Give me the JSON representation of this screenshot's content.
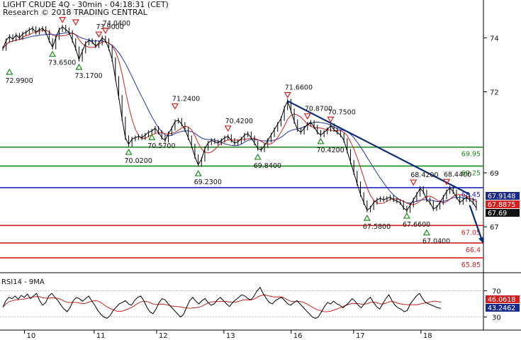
{
  "header": {
    "title": "LIGHT CRUDE 4Q - 30min - 04:18:31 (CET)",
    "copyright": "Research © 2018 TRADING CENTRAL"
  },
  "rsi_panel": {
    "title": "RSI14 - 9MA"
  },
  "chart_data": [
    {
      "type": "line",
      "title": "LIGHT CRUDE 4Q - 30min - 04:18:31 (CET)",
      "x_ticks": [
        "10",
        "11",
        "12",
        "13",
        "16",
        "17",
        "18"
      ],
      "y_ticks": [
        "74",
        "72",
        "69",
        "67"
      ],
      "ylim": [
        65.3,
        75.4
      ],
      "series": [
        {
          "role": "price",
          "color": "#000000",
          "values": [
            73.6,
            73.9,
            74.05,
            73.95,
            74.1,
            74.0,
            74.15,
            74.2,
            74.3,
            74.35,
            74.2,
            74.3,
            74.35,
            74.2,
            73.9,
            73.65,
            74.0,
            74.3,
            74.4,
            74.3,
            74.2,
            73.9,
            73.6,
            73.2,
            73.5,
            73.8,
            73.9,
            73.85,
            73.7,
            73.8,
            74.0,
            73.9,
            73.6,
            73.2,
            72.5,
            71.8,
            71.0,
            70.3,
            70.05,
            70.25,
            70.3,
            70.35,
            70.3,
            70.4,
            70.5,
            70.55,
            70.65,
            70.5,
            70.3,
            70.2,
            70.45,
            70.65,
            70.9,
            70.95,
            70.8,
            70.6,
            70.3,
            70.0,
            69.6,
            69.3,
            69.5,
            69.9,
            70.1,
            70.2,
            70.15,
            70.1,
            70.2,
            70.3,
            70.35,
            70.2,
            70.1,
            70.15,
            70.25,
            70.4,
            70.45,
            70.3,
            70.1,
            69.9,
            69.85,
            70.0,
            70.2,
            70.4,
            70.6,
            70.8,
            71.0,
            71.4,
            71.66,
            71.3,
            70.9,
            70.6,
            70.5,
            70.65,
            70.8,
            70.87,
            70.7,
            70.5,
            70.4,
            70.5,
            70.6,
            70.75,
            70.6,
            70.5,
            70.4,
            70.2,
            69.8,
            69.4,
            69.0,
            68.6,
            68.2,
            67.9,
            67.62,
            67.7,
            67.9,
            68.0,
            68.05,
            68.0,
            68.05,
            68.1,
            68.0,
            67.95,
            67.9,
            67.7,
            67.6,
            67.8,
            68.0,
            68.2,
            68.42,
            68.3,
            68.0,
            67.9,
            67.67,
            67.72,
            67.9,
            68.1,
            68.3,
            68.44,
            68.3,
            68.1,
            67.9,
            68.0,
            68.1,
            68.0,
            67.9,
            67.69
          ],
          "last": "67.69"
        },
        {
          "role": "short-ma",
          "color": "#cc2222",
          "values": [],
          "last": "67.8875"
        },
        {
          "role": "long-ma",
          "color": "#2233aa",
          "values": [],
          "last": "67.9148"
        }
      ],
      "annotations": [
        {
          "kind": "low",
          "text": "72.9900",
          "x": 2,
          "y": 72.99
        },
        {
          "kind": "low",
          "text": "73.6500",
          "x": 15,
          "y": 73.65
        },
        {
          "kind": "low",
          "text": "73.1700",
          "x": 23,
          "y": 73.17
        },
        {
          "kind": "high",
          "text": "74.4400",
          "x": 18,
          "y": 74.44
        },
        {
          "kind": "high",
          "text": "74.3500",
          "x": 22,
          "y": 74.35
        },
        {
          "kind": "high",
          "text": "73.9000",
          "x": 29,
          "y": 73.9
        },
        {
          "kind": "high",
          "text": "74.0400",
          "x": 31,
          "y": 74.04
        },
        {
          "kind": "low",
          "text": "70.0200",
          "x": 38,
          "y": 70.02
        },
        {
          "kind": "high",
          "text": "71.2400",
          "x": 52,
          "y": 71.24
        },
        {
          "kind": "low",
          "text": "70.5700",
          "x": 45,
          "y": 70.57
        },
        {
          "kind": "low",
          "text": "69.2300",
          "x": 59,
          "y": 69.23
        },
        {
          "kind": "high",
          "text": "70.4200",
          "x": 68,
          "y": 70.42
        },
        {
          "kind": "low",
          "text": "69.8400",
          "x": 77,
          "y": 69.84
        },
        {
          "kind": "high",
          "text": "71.6600",
          "x": 86,
          "y": 71.66
        },
        {
          "kind": "high",
          "text": "70.8700",
          "x": 92,
          "y": 70.87
        },
        {
          "kind": "high",
          "text": "70.7500",
          "x": 99,
          "y": 70.75
        },
        {
          "kind": "low",
          "text": "70.4200",
          "x": 96,
          "y": 70.42
        },
        {
          "kind": "low",
          "text": "67.5800",
          "x": 110,
          "y": 67.58
        },
        {
          "kind": "low",
          "text": "67.6600",
          "x": 122,
          "y": 67.66
        },
        {
          "kind": "high",
          "text": "68.4200",
          "x": 124,
          "y": 68.42
        },
        {
          "kind": "high",
          "text": "68.4400",
          "x": 134,
          "y": 68.44
        },
        {
          "kind": "low",
          "text": "67.0400",
          "x": 128,
          "y": 67.04
        }
      ],
      "levels": [
        {
          "value": 69.95,
          "label": "69.95",
          "color": "#1a8a1a"
        },
        {
          "value": 69.25,
          "label": "69.25",
          "color": "#1a8a1a"
        },
        {
          "value": 68.45,
          "label": "68.45",
          "color": "#2222cc"
        },
        {
          "value": 67.05,
          "label": "67.05",
          "color": "#d42020"
        },
        {
          "value": 66.4,
          "label": "66.4",
          "color": "#d42020"
        },
        {
          "value": 65.85,
          "label": "65.85",
          "color": "#d42020"
        }
      ],
      "trendline": {
        "color": "#0a2a7a",
        "from": [
          86,
          71.66
        ],
        "to": [
          141,
          68.2
        ]
      },
      "projection_arrow": {
        "color": "#0a2a7a",
        "from": [
          141,
          67.8
        ],
        "to": [
          145,
          66.4
        ]
      },
      "last_value_tags": [
        {
          "text": "67.9148",
          "bg": "#1a2a8a",
          "fg": "#ffffff"
        },
        {
          "text": "67.8875",
          "bg": "#d42020",
          "fg": "#ffffff"
        },
        {
          "text": "67.69",
          "bg": "#111111",
          "fg": "#ffffff"
        }
      ]
    },
    {
      "type": "line",
      "title": "RSI14 - 9MA",
      "y_ticks": [
        "70",
        "30"
      ],
      "ylim": [
        10,
        90
      ],
      "series": [
        {
          "role": "rsi",
          "color": "#000000",
          "values": [
            45,
            55,
            60,
            58,
            62,
            57,
            63,
            60,
            65,
            58,
            62,
            66,
            55,
            48,
            52,
            62,
            66,
            60,
            55,
            48,
            42,
            38,
            45,
            55,
            60,
            58,
            54,
            58,
            62,
            55,
            48,
            40,
            34,
            30,
            28,
            32,
            40,
            45,
            50,
            52,
            55,
            50,
            48,
            55,
            60,
            62,
            55,
            45,
            38,
            35,
            42,
            52,
            58,
            56,
            50,
            45,
            40,
            35,
            30,
            34,
            45,
            55,
            60,
            54,
            50,
            55,
            58,
            52,
            48,
            50,
            56,
            60,
            55,
            50,
            46,
            52,
            56,
            60,
            64,
            62,
            58,
            56,
            62,
            70,
            75,
            66,
            58,
            52,
            50,
            55,
            58,
            60,
            55,
            50,
            48,
            52,
            55,
            50,
            45,
            40,
            35,
            30,
            28,
            30,
            38,
            46,
            52,
            50,
            54,
            50,
            48,
            44,
            48,
            52,
            58,
            54,
            48,
            44,
            50,
            56,
            60,
            52,
            46,
            42,
            50,
            58,
            64,
            55,
            48,
            44,
            42,
            38,
            40,
            50,
            56,
            62,
            66,
            58,
            52,
            50,
            48,
            46,
            44,
            43.2
          ],
          "last": "43.2462"
        },
        {
          "role": "rsi-ma",
          "color": "#cc2222",
          "values": [],
          "last": "46.0618"
        }
      ],
      "last_value_tags": [
        {
          "text": "46.0618",
          "bg": "#d42020",
          "fg": "#ffffff"
        },
        {
          "text": "43.2462",
          "bg": "#1a2a8a",
          "fg": "#ffffff"
        }
      ]
    }
  ]
}
